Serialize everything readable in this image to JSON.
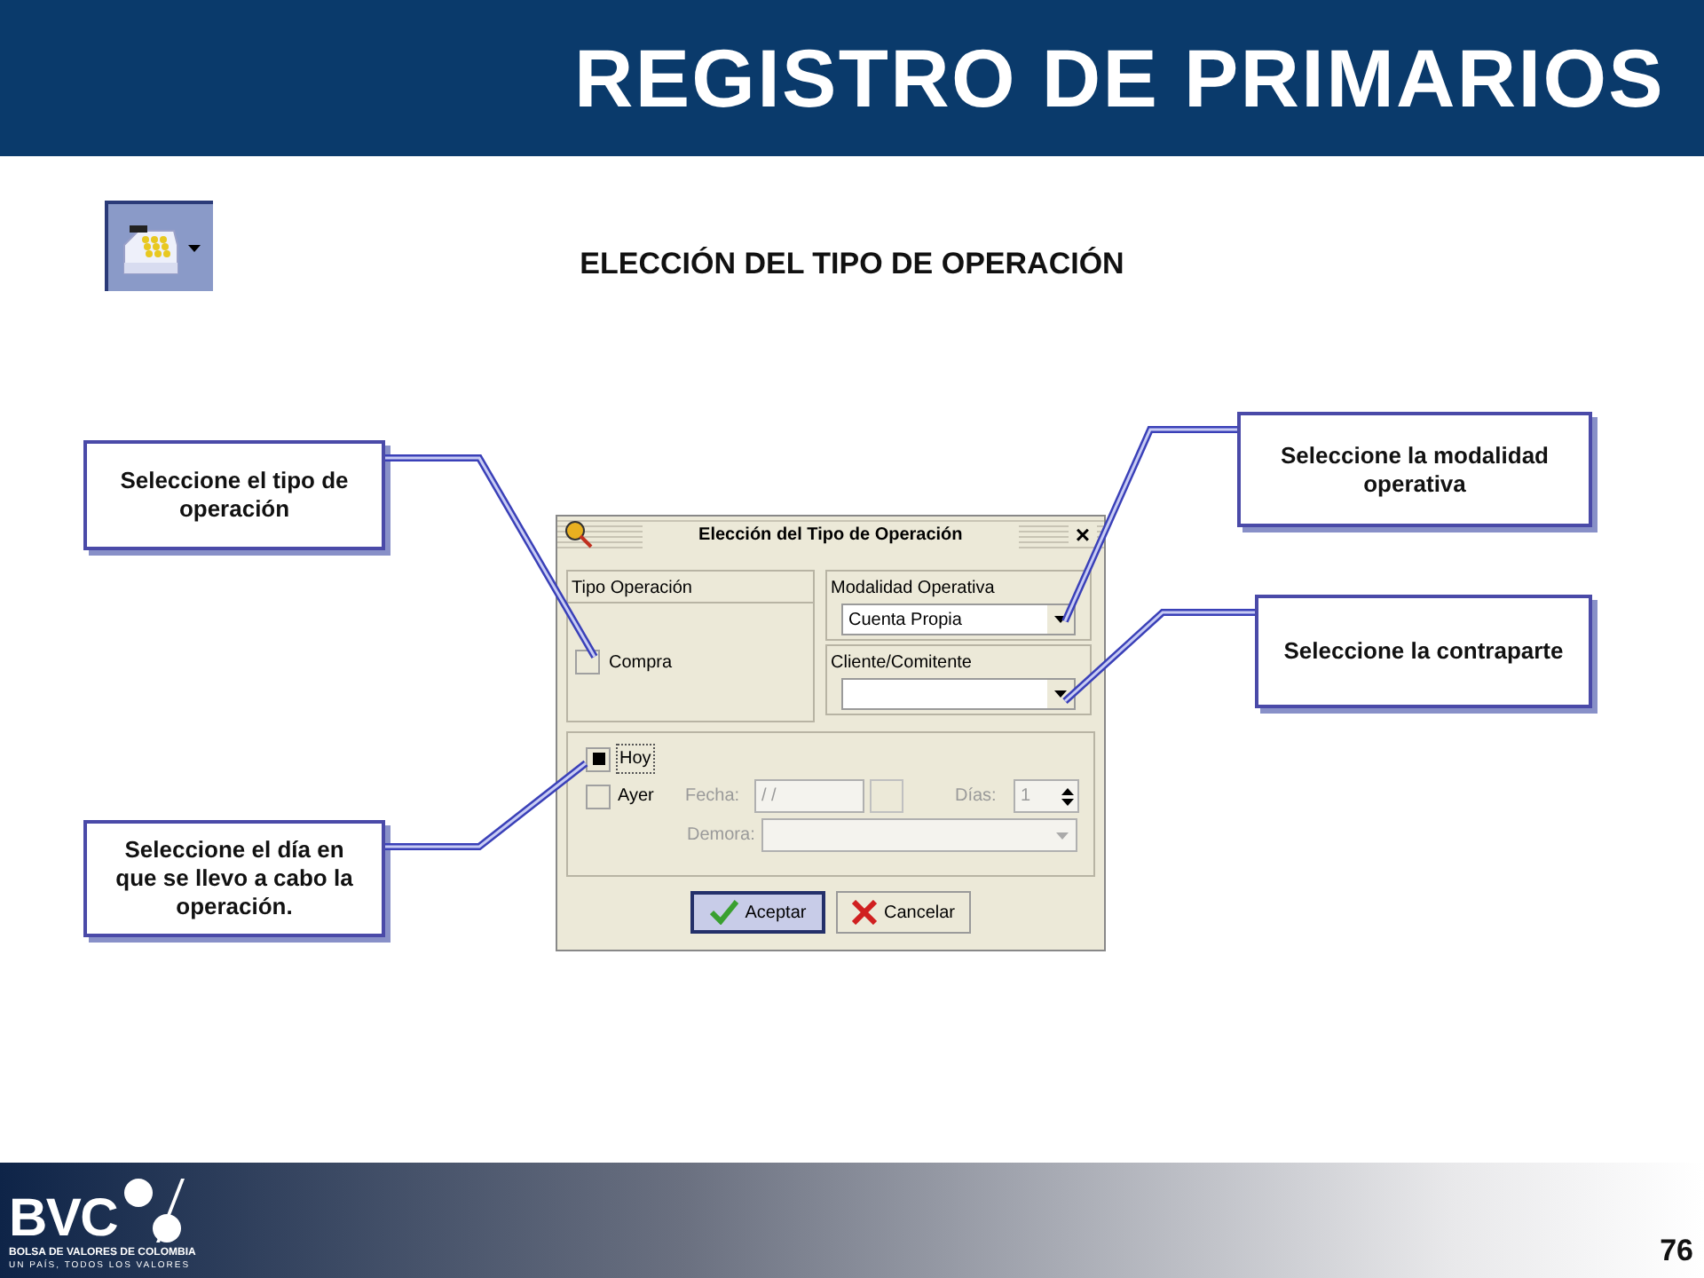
{
  "header": {
    "title": "REGISTRO DE PRIMARIOS"
  },
  "section_title": "ELECCIÓN DEL TIPO DE OPERACIÓN",
  "callouts": [
    {
      "text": "Seleccione el tipo de operación"
    },
    {
      "text": "Seleccione el día en que se llevo a cabo la operación."
    },
    {
      "text": "Seleccione la modalidad operativa"
    },
    {
      "text": "Seleccione la contraparte"
    }
  ],
  "dialog": {
    "title": "Elección del Tipo de Operación",
    "close": "×",
    "tipo_operacion": {
      "label": "Tipo Operación",
      "options": [
        {
          "label": "Compra",
          "checked": false
        }
      ]
    },
    "modalidad": {
      "label": "Modalidad Operativa",
      "value": "Cuenta Propia"
    },
    "cliente": {
      "label": "Cliente/Comitente"
    },
    "dia": [
      {
        "label": "Hoy",
        "checked": true
      },
      {
        "label": "Ayer",
        "checked": false
      }
    ],
    "fecha": {
      "label": "Fecha:",
      "value": "/ /",
      "disabled": true
    },
    "dias": {
      "label": "Días:",
      "value": "1",
      "disabled": true
    },
    "demora": {
      "label": "Demora:",
      "disabled": true
    },
    "buttons": [
      {
        "label": "Aceptar",
        "kind": "accept"
      },
      {
        "label": "Cancelar",
        "kind": "cancel"
      }
    ]
  },
  "footer": {
    "logo_mark": "BVC",
    "logo_name": "BOLSA DE VALORES DE COLOMBIA",
    "logo_tagline": "UN PAÍS, TODOS LOS VALORES",
    "page": "76"
  }
}
